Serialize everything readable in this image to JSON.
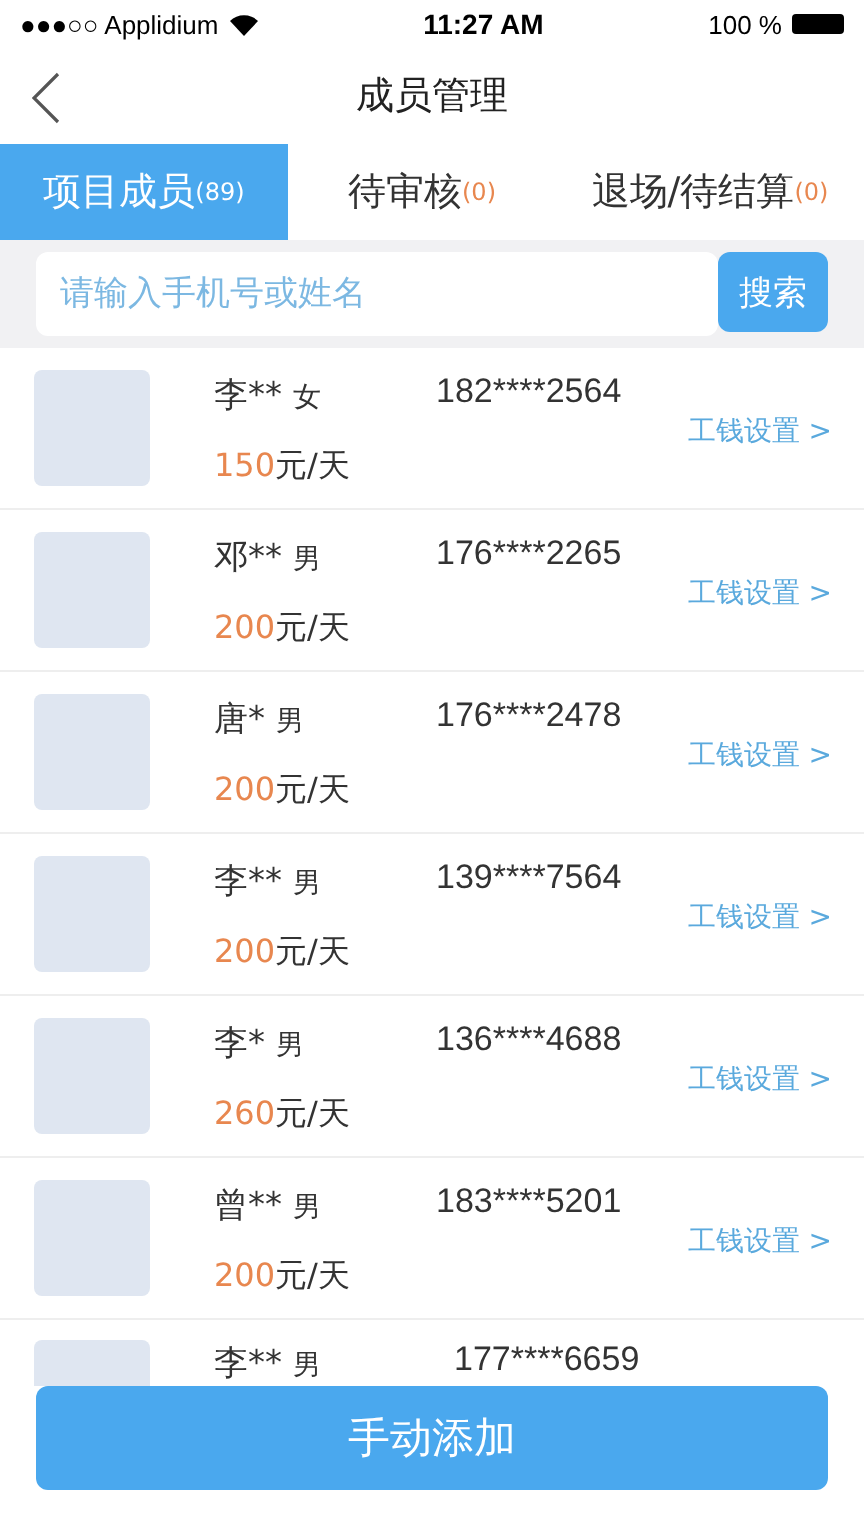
{
  "status_bar": {
    "carrier": "●●●○○ Applidium",
    "time": "11:27 AM",
    "battery": "100 %"
  },
  "nav": {
    "title": "成员管理"
  },
  "tabs": [
    {
      "label": "项目成员",
      "count": "(89)",
      "selected": true
    },
    {
      "label": "待审核",
      "count": "(0)",
      "selected": false
    },
    {
      "label": "退场/待结算",
      "count": "(0)",
      "selected": false
    }
  ],
  "search": {
    "placeholder": "请输入手机号或姓名",
    "button": "搜索"
  },
  "members": [
    {
      "name": "李**",
      "gender": "女",
      "phone": "182****2564",
      "wage": "150",
      "unit": "元/天",
      "action": "工钱设置 >"
    },
    {
      "name": "邓**",
      "gender": "男",
      "phone": "176****2265",
      "wage": "200",
      "unit": "元/天",
      "action": "工钱设置 >"
    },
    {
      "name": "唐*",
      "gender": "男",
      "phone": "176****2478",
      "wage": "200",
      "unit": "元/天",
      "action": "工钱设置 >"
    },
    {
      "name": "李**",
      "gender": "男",
      "phone": "139****7564",
      "wage": "200",
      "unit": "元/天",
      "action": "工钱设置 >"
    },
    {
      "name": "李*",
      "gender": "男",
      "phone": "136****4688",
      "wage": "260",
      "unit": "元/天",
      "action": "工钱设置 >"
    },
    {
      "name": "曾**",
      "gender": "男",
      "phone": "183****5201",
      "wage": "200",
      "unit": "元/天",
      "action": "工钱设置 >"
    },
    {
      "name": "李**",
      "gender": "男",
      "phone": "177****6659"
    }
  ],
  "add_button": "手动添加"
}
